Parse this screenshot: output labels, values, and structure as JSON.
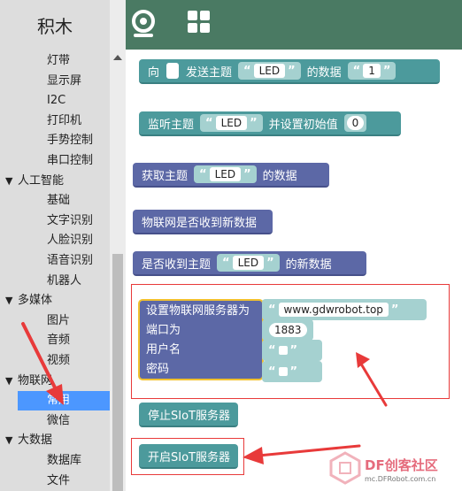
{
  "toolbox": {
    "title": "积木",
    "items": [
      {
        "label": "灯带",
        "type": "sub"
      },
      {
        "label": "显示屏",
        "type": "sub"
      },
      {
        "label": "I2C",
        "type": "sub"
      },
      {
        "label": "打印机",
        "type": "sub"
      },
      {
        "label": "手势控制",
        "type": "sub"
      },
      {
        "label": "串口控制",
        "type": "sub"
      },
      {
        "label": "人工智能",
        "type": "head"
      },
      {
        "label": "基础",
        "type": "sub"
      },
      {
        "label": "文字识别",
        "type": "sub"
      },
      {
        "label": "人脸识别",
        "type": "sub"
      },
      {
        "label": "语音识别",
        "type": "sub"
      },
      {
        "label": "机器人",
        "type": "sub"
      },
      {
        "label": "多媒体",
        "type": "head"
      },
      {
        "label": "图片",
        "type": "sub"
      },
      {
        "label": "音频",
        "type": "sub"
      },
      {
        "label": "视频",
        "type": "sub"
      },
      {
        "label": "物联网",
        "type": "head"
      },
      {
        "label": "常用",
        "type": "sub",
        "selected": true
      },
      {
        "label": "微信",
        "type": "sub"
      },
      {
        "label": "大数据",
        "type": "head"
      },
      {
        "label": "数据库",
        "type": "sub"
      },
      {
        "label": "文件",
        "type": "sub"
      }
    ],
    "expand_glyph": "▼"
  },
  "topbar": {
    "icons": [
      "webcam-icon",
      "grid-icon"
    ],
    "color": "#4a7a63"
  },
  "blocks": {
    "send": {
      "prefix": "向",
      "label": "发送主题",
      "topic": "LED",
      "data_label": "的数据",
      "value": "1"
    },
    "monitor": {
      "label": "监听主题",
      "topic": "LED",
      "init_label": "并设置初始值",
      "value": "0"
    },
    "get": {
      "label": "获取主题",
      "topic": "LED",
      "data_label": "的数据"
    },
    "received_any": {
      "label": "物联网是否收到新数据"
    },
    "received_topic": {
      "label": "是否收到主题",
      "topic": "LED",
      "data_label": "的新数据"
    },
    "server": {
      "label": "设置物联网服务器为",
      "host": "www.gdwrobot.top",
      "port_label": "端口为",
      "port": "1883",
      "user_label": "用户名",
      "pass_label": "密码"
    },
    "stop": {
      "label": "停止SIoT服务器"
    },
    "start": {
      "label": "开启SIoT服务器"
    }
  },
  "quote_open": "“",
  "quote_close": "”",
  "colors": {
    "teal": "#4c9a9c",
    "purple": "#5c68a6",
    "highlight": "#f2c12e",
    "annotation": "#e83a3a",
    "selected": "#4c97ff"
  },
  "watermark": {
    "brand": "DF创客社区",
    "site": "mc.DFRobot.com.cn"
  }
}
